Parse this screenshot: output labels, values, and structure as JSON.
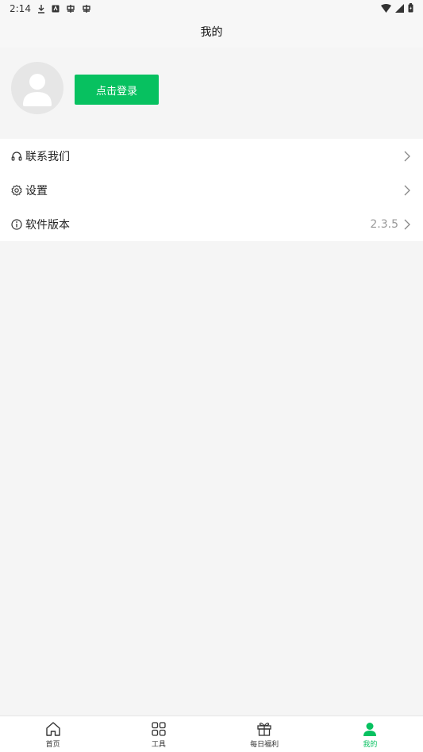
{
  "status_bar": {
    "time": "2:14"
  },
  "header": {
    "title": "我的"
  },
  "profile": {
    "login_label": "点击登录"
  },
  "menu": {
    "items": [
      {
        "label": "联系我们",
        "icon": "headset-icon"
      },
      {
        "label": "设置",
        "icon": "gear-icon"
      },
      {
        "label": "软件版本",
        "icon": "info-icon",
        "value": "2.3.5"
      }
    ]
  },
  "bottom_nav": {
    "items": [
      {
        "label": "首页",
        "icon": "home-icon"
      },
      {
        "label": "工具",
        "icon": "grid-icon"
      },
      {
        "label": "每日福利",
        "icon": "gift-icon"
      },
      {
        "label": "我的",
        "icon": "person-icon",
        "active": true
      }
    ]
  },
  "colors": {
    "accent": "#07c160",
    "background": "#f5f5f5"
  }
}
